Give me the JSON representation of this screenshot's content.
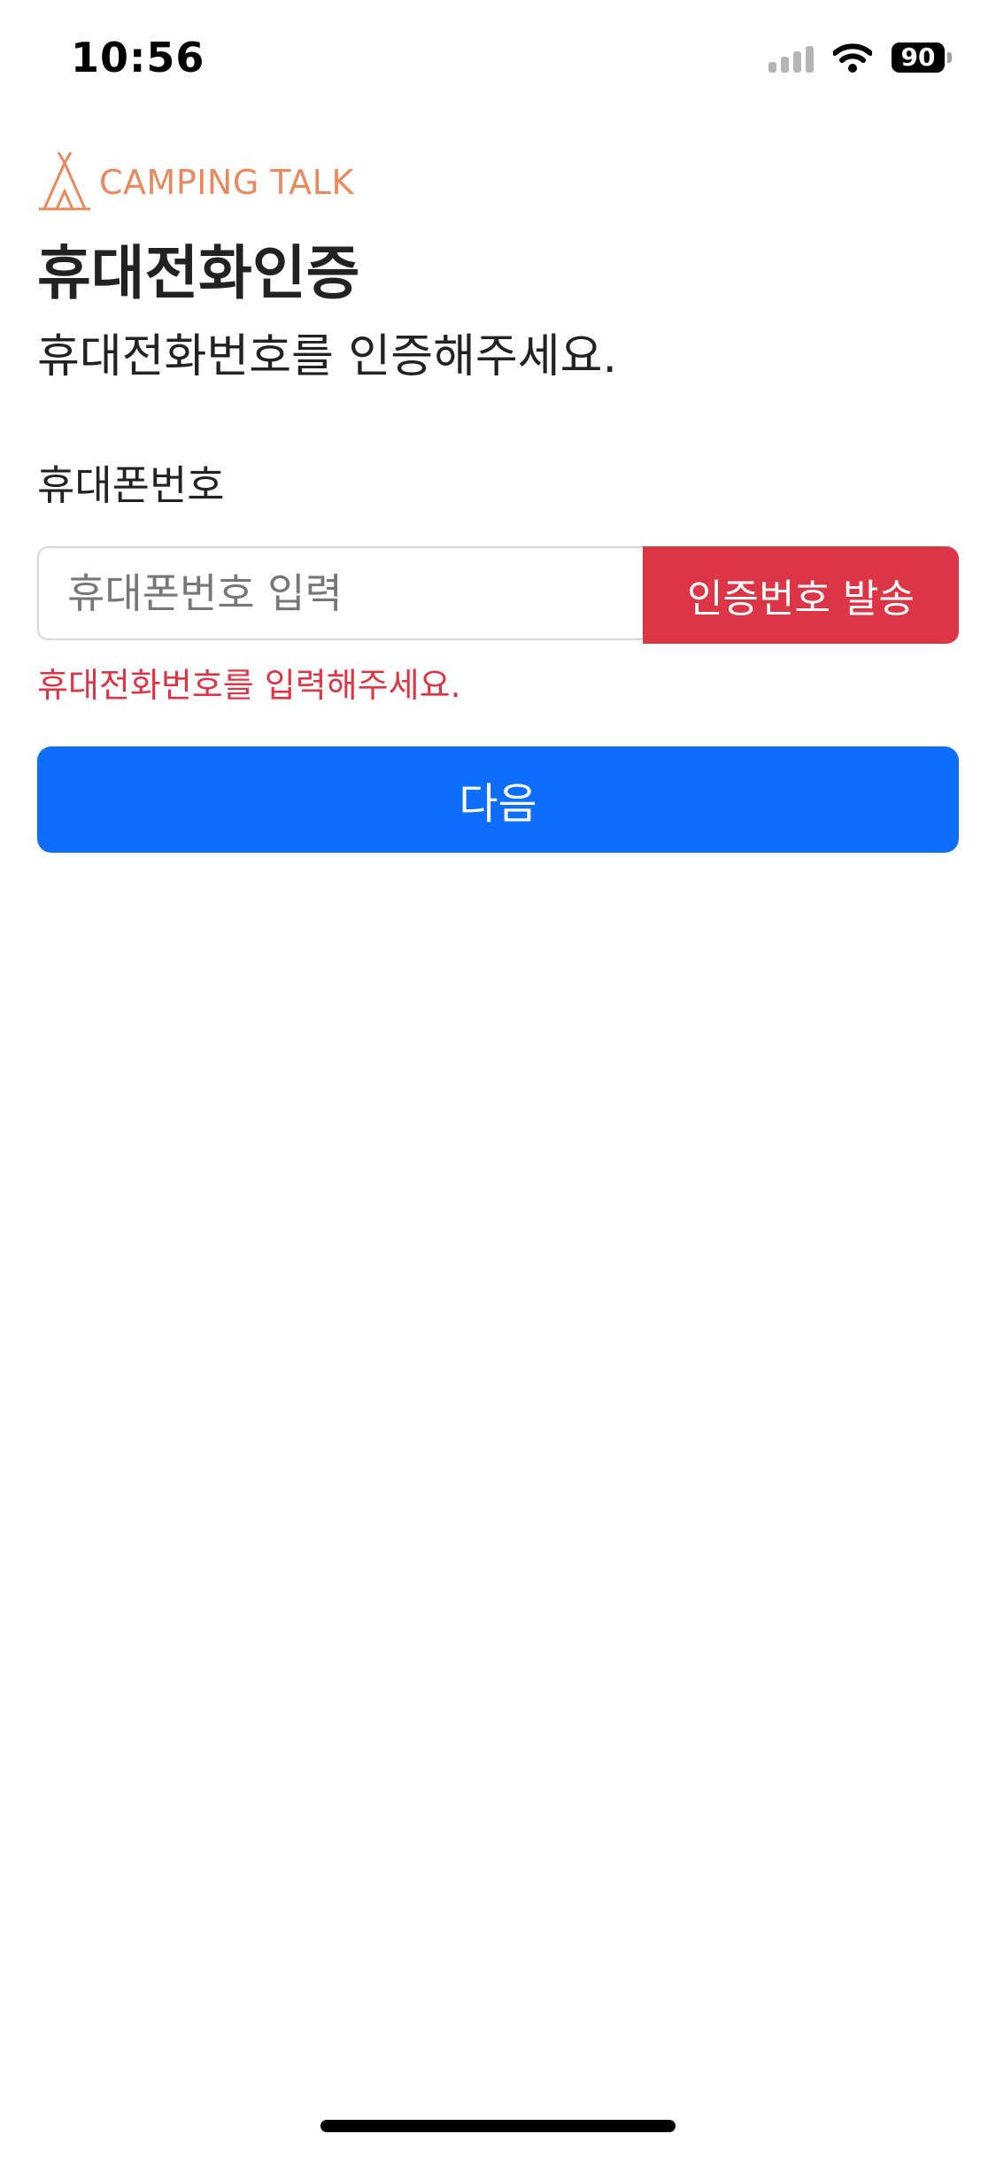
{
  "status_bar": {
    "time": "10:56",
    "battery_level": "90",
    "icons": [
      "signal-icon",
      "wifi-icon",
      "battery-icon"
    ]
  },
  "brand": {
    "name": "CAMPING TALK",
    "color": "#e9895f",
    "icon": "tent-icon"
  },
  "page": {
    "title": "휴대전화인증",
    "subtitle": "휴대전화번호를 인증해주세요."
  },
  "form": {
    "phone_label": "휴대폰번호",
    "phone_value": "",
    "phone_placeholder": "휴대폰번호 입력",
    "send_code_label": "인증번호 발송",
    "error_message": "휴대전화번호를 입력해주세요.",
    "next_label": "다음"
  },
  "colors": {
    "danger": "#dc3545",
    "primary": "#0d6efd"
  }
}
